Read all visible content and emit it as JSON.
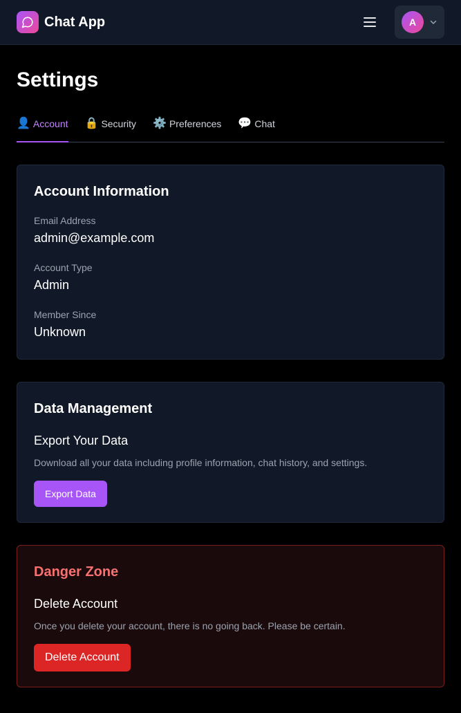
{
  "header": {
    "app_name": "Chat App",
    "avatar_initial": "A"
  },
  "page": {
    "title": "Settings"
  },
  "tabs": [
    {
      "icon": "👤",
      "label": "Account",
      "active": true
    },
    {
      "icon": "🔒",
      "label": "Security",
      "active": false
    },
    {
      "icon": "⚙️",
      "label": "Preferences",
      "active": false
    },
    {
      "icon": "💬",
      "label": "Chat",
      "active": false
    }
  ],
  "account": {
    "title": "Account Information",
    "fields": [
      {
        "label": "Email Address",
        "value": "admin@example.com"
      },
      {
        "label": "Account Type",
        "value": "Admin"
      },
      {
        "label": "Member Since",
        "value": "Unknown"
      }
    ]
  },
  "data_management": {
    "title": "Data Management",
    "section_title": "Export Your Data",
    "description": "Download all your data including profile information, chat history, and settings.",
    "button_label": "Export Data"
  },
  "danger_zone": {
    "title": "Danger Zone",
    "section_title": "Delete Account",
    "description": "Once you delete your account, there is no going back. Please be certain.",
    "button_label": "Delete Account"
  },
  "colors": {
    "accent": "#a855f7",
    "danger": "#dc2626",
    "danger_text": "#f87171",
    "card_bg": "#111827",
    "page_bg": "#000000"
  }
}
